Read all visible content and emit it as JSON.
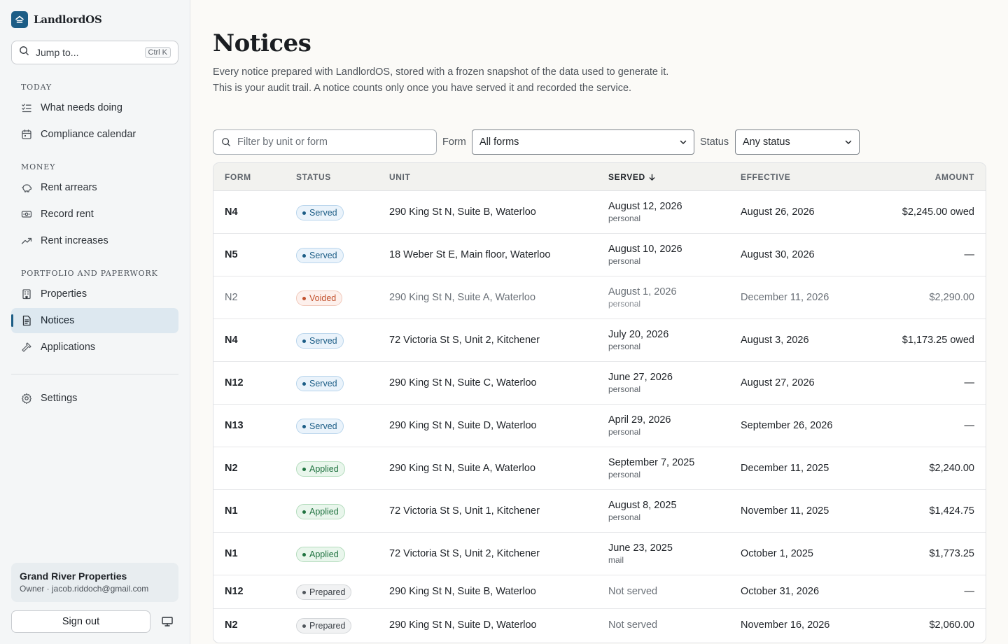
{
  "app": {
    "name": "LandlordOS"
  },
  "jump": {
    "placeholder": "Jump to...",
    "shortcut": "Ctrl K"
  },
  "sidebar": {
    "sections": [
      {
        "title": "TODAY"
      },
      {
        "title": "MONEY"
      },
      {
        "title": "PORTFOLIO AND PAPERWORK"
      }
    ],
    "items": [
      {
        "label": "What needs doing",
        "icon": "checklist-icon"
      },
      {
        "label": "Compliance calendar",
        "icon": "calendar-icon"
      },
      {
        "label": "Rent arrears",
        "icon": "piggy-bank-icon"
      },
      {
        "label": "Record rent",
        "icon": "banknote-icon"
      },
      {
        "label": "Rent increases",
        "icon": "trending-up-icon"
      },
      {
        "label": "Properties",
        "icon": "building-icon"
      },
      {
        "label": "Notices",
        "icon": "document-icon",
        "active": true
      },
      {
        "label": "Applications",
        "icon": "hammer-icon"
      },
      {
        "label": "Settings",
        "icon": "gear-icon"
      }
    ],
    "org": {
      "name": "Grand River Properties",
      "meta": "Owner · jacob.riddoch@gmail.com"
    },
    "signout_label": "Sign out"
  },
  "page": {
    "title": "Notices",
    "subtitle_line1": "Every notice prepared with LandlordOS, stored with a frozen snapshot of the data used to generate it.",
    "subtitle_line2": "This is your audit trail. A notice counts only once you have served it and recorded the service."
  },
  "filters": {
    "search_placeholder": "Filter by unit or form",
    "form_label": "Form",
    "form_value": "All forms",
    "status_label": "Status",
    "status_value": "Any status"
  },
  "table": {
    "headers": {
      "form": "FORM",
      "status": "STATUS",
      "unit": "UNIT",
      "served": "SERVED",
      "effective": "EFFECTIVE",
      "amount": "AMOUNT"
    },
    "rows": [
      {
        "form": "N4",
        "status": "Served",
        "unit": "290 King St N, Suite B, Waterloo",
        "served": "August 12, 2026",
        "method": "personal",
        "effective": "August 26, 2026",
        "amount": "$2,245.00 owed"
      },
      {
        "form": "N5",
        "status": "Served",
        "unit": "18 Weber St E, Main floor, Waterloo",
        "served": "August 10, 2026",
        "method": "personal",
        "effective": "August 30, 2026",
        "amount": "—"
      },
      {
        "form": "N2",
        "status": "Voided",
        "unit": "290 King St N, Suite A, Waterloo",
        "served": "August 1, 2026",
        "method": "personal",
        "effective": "December 11, 2026",
        "amount": "$2,290.00"
      },
      {
        "form": "N4",
        "status": "Served",
        "unit": "72 Victoria St S, Unit 2, Kitchener",
        "served": "July 20, 2026",
        "method": "personal",
        "effective": "August 3, 2026",
        "amount": "$1,173.25 owed"
      },
      {
        "form": "N12",
        "status": "Served",
        "unit": "290 King St N, Suite C, Waterloo",
        "served": "June 27, 2026",
        "method": "personal",
        "effective": "August 27, 2026",
        "amount": "—"
      },
      {
        "form": "N13",
        "status": "Served",
        "unit": "290 King St N, Suite D, Waterloo",
        "served": "April 29, 2026",
        "method": "personal",
        "effective": "September 26, 2026",
        "amount": "—"
      },
      {
        "form": "N2",
        "status": "Applied",
        "unit": "290 King St N, Suite A, Waterloo",
        "served": "September 7, 2025",
        "method": "personal",
        "effective": "December 11, 2025",
        "amount": "$2,240.00"
      },
      {
        "form": "N1",
        "status": "Applied",
        "unit": "72 Victoria St S, Unit 1, Kitchener",
        "served": "August 8, 2025",
        "method": "personal",
        "effective": "November 11, 2025",
        "amount": "$1,424.75"
      },
      {
        "form": "N1",
        "status": "Applied",
        "unit": "72 Victoria St S, Unit 2, Kitchener",
        "served": "June 23, 2025",
        "method": "mail",
        "effective": "October 1, 2025",
        "amount": "$1,773.25"
      },
      {
        "form": "N12",
        "status": "Prepared",
        "unit": "290 King St N, Suite B, Waterloo",
        "served": "Not served",
        "method": "",
        "effective": "October 31, 2026",
        "amount": "—"
      },
      {
        "form": "N2",
        "status": "Prepared",
        "unit": "290 King St N, Suite D, Waterloo",
        "served": "Not served",
        "method": "",
        "effective": "November 16, 2026",
        "amount": "$2,060.00"
      }
    ]
  },
  "colors": {
    "brand": "#1c5d86",
    "served": "#1c5d86",
    "voided": "#c2522e",
    "applied": "#207340",
    "prepared": "#50565c"
  }
}
